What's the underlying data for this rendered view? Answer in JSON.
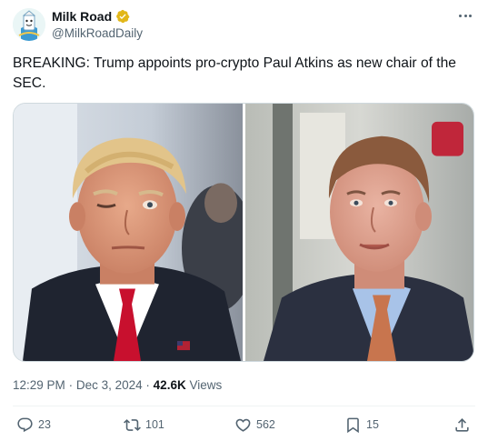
{
  "author": {
    "display_name": "Milk Road",
    "handle": "@MilkRoadDaily",
    "verified": true,
    "avatar_icon": "milk-carton-mascot-icon"
  },
  "tweet": {
    "text": "BREAKING: Trump appoints pro-crypto Paul Atkins as new chair of the SEC.",
    "media": [
      {
        "subject": "Donald Trump portrait"
      },
      {
        "subject": "Paul Atkins portrait"
      }
    ]
  },
  "meta": {
    "time": "12:29 PM",
    "separator": "·",
    "date": "Dec 3, 2024",
    "views_count": "42.6K",
    "views_label": "Views"
  },
  "actions": {
    "reply_count": "23",
    "retweet_count": "101",
    "like_count": "562",
    "bookmark_count": "15"
  },
  "colors": {
    "text_primary": "#0f1419",
    "text_secondary": "#536471",
    "verified_gold": "#e2b719",
    "border": "#cfd9de"
  }
}
